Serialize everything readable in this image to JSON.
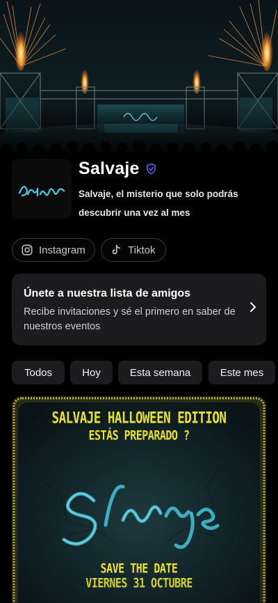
{
  "profile": {
    "name": "Salvaje",
    "description": "Salvaje, el misterio que solo podrás descubrir una vez al mes",
    "logo_text": "Salvaje"
  },
  "social": [
    {
      "label": "Instagram",
      "icon": "instagram-icon"
    },
    {
      "label": "Tiktok",
      "icon": "tiktok-icon"
    }
  ],
  "friends": {
    "title": "Únete a nuestra lista de amigos",
    "subtitle": "Recibe invitaciones y sé el primero en saber de nuestros eventos"
  },
  "filters": [
    "Todos",
    "Hoy",
    "Esta semana",
    "Este mes"
  ],
  "event": {
    "line1": "SALVAJE HALLOWEEN EDITION",
    "line2": "ESTÁS PREPARADO ?",
    "logo": "Salvaje",
    "line3": "SAVE THE DATE",
    "line4": "VIERNES 31 OCTUBRE"
  },
  "colors": {
    "verified": "#6e5bff",
    "card": "#1c1c1e",
    "poster_yellow": "#e9e12a",
    "neon": "#3fb6c8"
  }
}
